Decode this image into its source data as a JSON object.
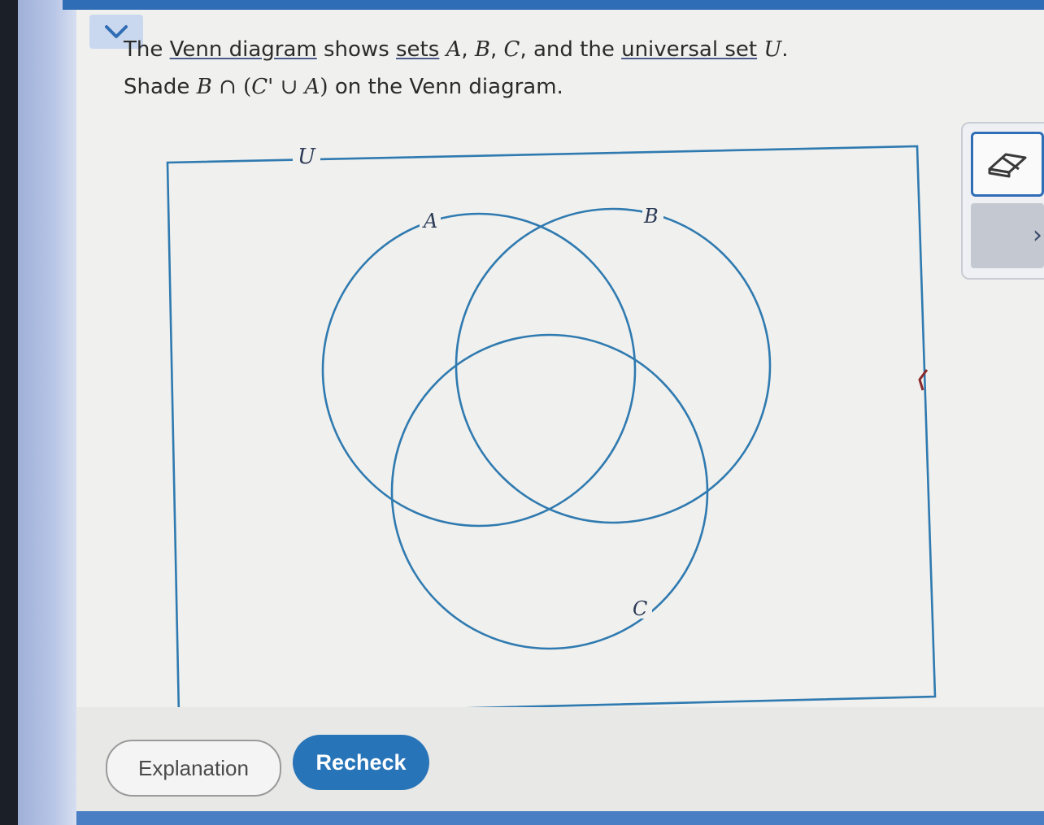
{
  "question": {
    "line1": {
      "w1": "The ",
      "link_venn": "Venn diagram",
      "w2": " shows ",
      "link_sets": "sets",
      "w3": " ",
      "a": "A",
      "c1": ", ",
      "b": "B",
      "c2": ", ",
      "c": "C",
      "w4": ", and the ",
      "link_universal": "universal set",
      "w5": " ",
      "u": "U",
      "period": "."
    },
    "line2": {
      "w1": "Shade ",
      "b": "B",
      "cap": " ∩ (",
      "c": "C",
      "prime_cup": "' ∪ ",
      "a": "A",
      "close": ")",
      "w2": " on the Venn diagram."
    }
  },
  "venn": {
    "universe_label": "U",
    "set_labels": {
      "a": "A",
      "b": "B",
      "c": "C"
    },
    "stroke_color": "#2f7ab0",
    "shaded_regions": []
  },
  "buttons": {
    "explanation": "Explanation",
    "recheck": "Recheck"
  },
  "icons": {
    "collapse": "chevron-down-icon",
    "eraser": "eraser-icon",
    "next": "chevron-right-icon"
  },
  "colors": {
    "accent": "#2874b8",
    "top_bar": "#2f6db6"
  }
}
